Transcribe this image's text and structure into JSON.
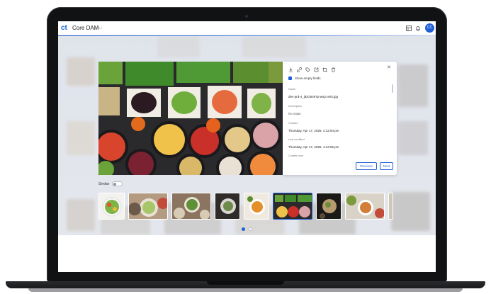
{
  "app": {
    "title": "Core DAM",
    "version": "v4.39.1",
    "logo_text": "ct",
    "avatar_initials": "CC",
    "accent": "#1f5fd6"
  },
  "header_icons": [
    "layout-icon",
    "bell-icon"
  ],
  "toolbar_icons": [
    "download-icon",
    "link-icon",
    "tag-icon",
    "share-icon",
    "crop-icon",
    "delete-icon",
    "close-icon"
  ],
  "panel": {
    "show_empty_label": "Show empty fields",
    "show_empty_checked": true,
    "fields": [
      {
        "label": "Name",
        "value": "dev-prd-4_jtDO5497p-wsp.resh.jpg"
      },
      {
        "label": "Description",
        "value": "No value"
      },
      {
        "label": "Created",
        "value": "Thursday, Apr 17, 2025, 4:12:54 pm"
      },
      {
        "label": "Last modified",
        "value": "Thursday, Apr 17, 2025, 4:13:05 pm"
      },
      {
        "label": "Content size",
        "value": ""
      }
    ],
    "previous_label": "Previous",
    "next_label": "Next"
  },
  "similar": {
    "label": "Similar",
    "toggle_on": false,
    "thumbnails": [
      {
        "name": "salad-bowl"
      },
      {
        "name": "grain-bowls"
      },
      {
        "name": "buddha-bowl-table"
      },
      {
        "name": "green-dish"
      },
      {
        "name": "soup-bowl"
      },
      {
        "name": "veggie-tray"
      },
      {
        "name": "dark-plate"
      },
      {
        "name": "dinner-spread"
      }
    ],
    "pages": 2,
    "active_page": 1
  }
}
